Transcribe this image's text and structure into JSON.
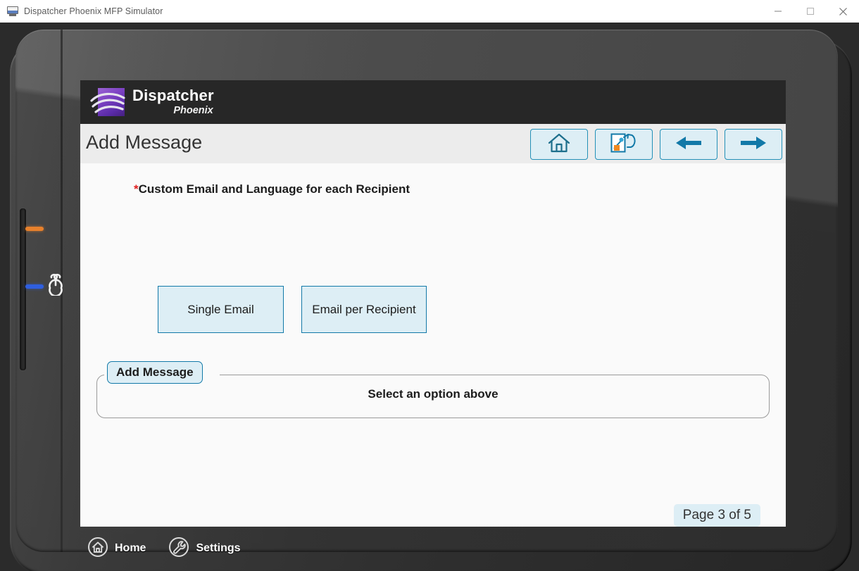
{
  "window": {
    "title": "Dispatcher Phoenix MFP Simulator",
    "icon": "monitor-icon",
    "controls": {
      "minimize": "minimize-icon",
      "maximize": "maximize-icon",
      "close": "close-icon"
    }
  },
  "device": {
    "indicators": {
      "orange_led": "orange-status-led",
      "blue_led": "blue-status-led",
      "power": "power-button-icon"
    }
  },
  "brand": {
    "title": "Dispatcher",
    "subtitle": "Phoenix",
    "logo_icon": "dispatcher-phoenix-logo"
  },
  "header": {
    "title": "Add Message",
    "toolbar": [
      {
        "name": "home-button",
        "icon": "home-icon"
      },
      {
        "name": "reset-button",
        "icon": "reset-document-icon"
      },
      {
        "name": "back-button",
        "icon": "arrow-left-icon"
      },
      {
        "name": "next-button",
        "icon": "arrow-right-icon"
      }
    ]
  },
  "main": {
    "required_marker": "*",
    "required_label": "Custom Email and Language for each Recipient",
    "options": [
      {
        "label": "Single Email"
      },
      {
        "label": "Email per Recipient"
      }
    ],
    "message_panel": {
      "legend": "Add Message",
      "empty_text": "Select an option above"
    },
    "page_indicator": "Page 3 of 5"
  },
  "bottom_nav": [
    {
      "label": "Home",
      "icon": "home-circle-icon"
    },
    {
      "label": "Settings",
      "icon": "wrench-circle-icon"
    }
  ],
  "colors": {
    "accent_border": "#1279a8",
    "accent_fill": "#ddeef5",
    "required_star": "#e02020",
    "brandbar_bg": "#272727",
    "header_bg": "#ececec",
    "screen_bg": "#fafafa"
  }
}
